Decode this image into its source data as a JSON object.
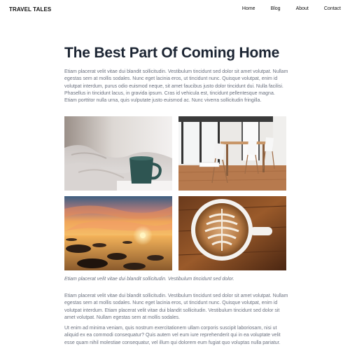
{
  "header": {
    "brand": "TRAVEL TALES",
    "nav": [
      "Home",
      "Blog",
      "About",
      "Contact"
    ]
  },
  "article": {
    "title": "The Best Part Of Coming Home",
    "intro": "Etiam placerat velit vitae dui blandit sollicitudin. Vestibulum tincidunt sed dolor sit amet volutpat. Nullam egestas sem at mollis sodales. Nunc eget lacinia eros, ut tincidunt nunc. Quisque volutpat, enim id volutpat interdum, purus odio euismod neque, sit amet faucibus justo dolor tincidunt dui. Nulla facilisi. Phasellus in tincidunt lacus, in gravida ipsum. Cras id vehicula est, tincidunt pellentesque magna. Etiam porttitor nulla urna, quis vulputate justo euismod ac. Nunc viverra sollicitudin fringilla.",
    "caption": "Etiam placerat velit vitae dui blandit sollicitudin. Vestibulum tincidunt sed dolor.",
    "body1": "Etiam placerat velit vitae dui blandit sollicitudin. Vestibulum tincidunt sed dolor sit amet volutpat. Nullam egestas sem at mollis sodales. Nunc eget lacinia eros, ut tincidunt nunc. Quisque volutpat, enim id volutpat interdum. Etiam placerat velit vitae dui blandit sollicitudin. Vestibulum tincidunt sed dolor sit amet volutpat. Nullam egestas sem at mollis sodales.",
    "body2": "Ut enim ad minima veniam, quis nostrum exercitationem ullam corporis suscipit laboriosam, nisi ut aliquid ex ea commodi consequatur? Quis autem vel eum iure reprehenderit qui in ea voluptate velit esse quam nihil molestiae consequatur, vel illum qui dolorem eum fugiat quo voluptas nulla pariatur."
  },
  "gallery": {
    "photos": [
      "mug-on-bed-photo",
      "dining-table-photo",
      "sunset-beach-photo",
      "latte-art-photo"
    ]
  }
}
